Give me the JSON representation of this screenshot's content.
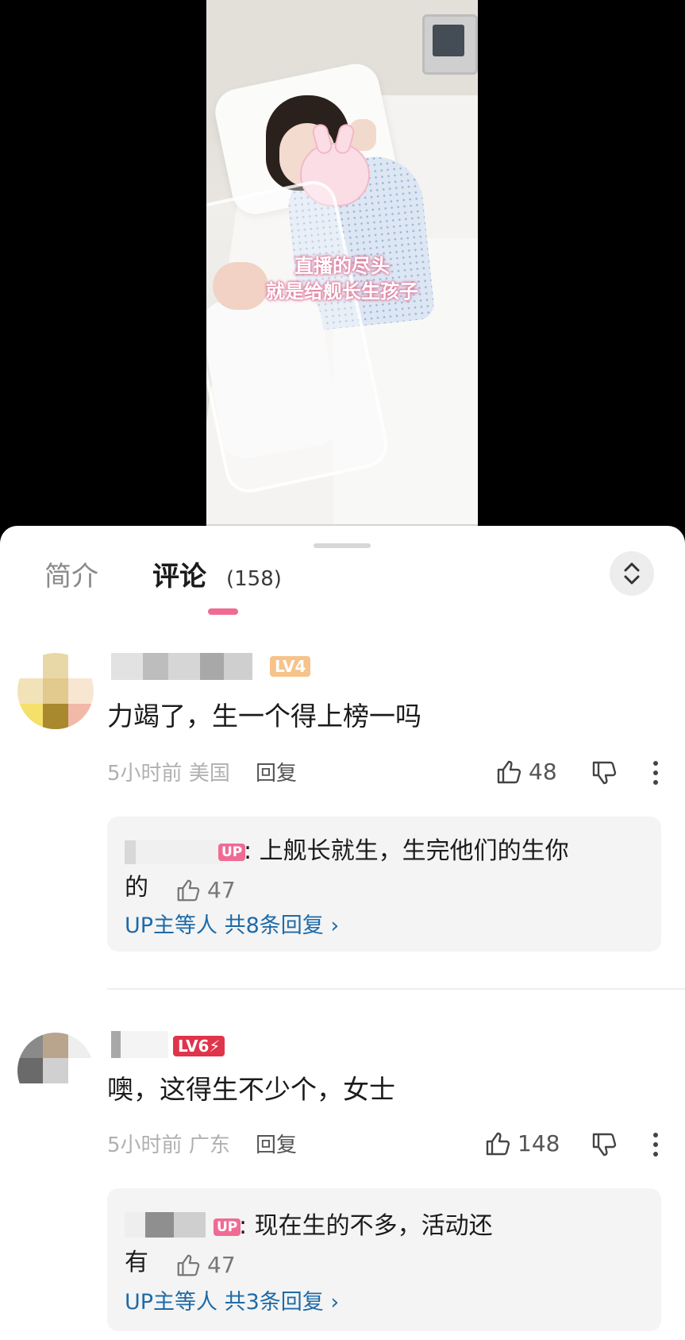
{
  "video": {
    "caption_line1": "直播的尽头",
    "caption_line2": "就是给舰长生孩子"
  },
  "tabs": {
    "intro_label": "简介",
    "comments_label": "评论",
    "comments_count": "(158)"
  },
  "comments": [
    {
      "level": "LV4",
      "text": "力竭了，生一个得上榜一吗",
      "time": "5小时前",
      "location": "美国",
      "reply_label": "回复",
      "likes": "48",
      "reply": {
        "badge": "UP",
        "text_line1": ": 上舰长就生，生完他们的生你",
        "text_line2": "的",
        "likes": "47",
        "more_label": "UP主等人 共8条回复 ›"
      }
    },
    {
      "level": "LV6⚡",
      "text": "噢，这得生不少个，女士",
      "time": "5小时前",
      "location": "广东",
      "reply_label": "回复",
      "likes": "148",
      "reply": {
        "badge": "UP",
        "text_line1": ": 现在生的不多，活动还",
        "text_line2": "有",
        "likes": "47",
        "more_label": "UP主等人 共3条回复 ›"
      }
    }
  ],
  "colors": {
    "accent_pink": "#f06b94",
    "link_blue": "#1e6ba8",
    "level4": "#f6c38a",
    "level6": "#e0344b"
  },
  "icons": [
    "thumbs-up-icon",
    "thumbs-down-icon",
    "more-vertical-icon",
    "sort-toggle-icon"
  ]
}
